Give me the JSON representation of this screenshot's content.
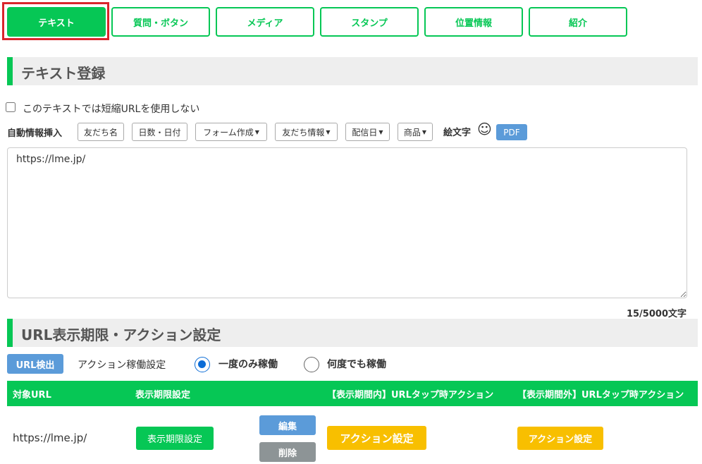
{
  "tabs": [
    {
      "label": "テキスト"
    },
    {
      "label": "質問・ボタン"
    },
    {
      "label": "メディア"
    },
    {
      "label": "スタンプ"
    },
    {
      "label": "位置情報"
    },
    {
      "label": "紹介"
    }
  ],
  "text_section": {
    "title": "テキスト登録",
    "no_short_url_label": "このテキストでは短縮URLを使用しない",
    "auto_insert_label": "自動情報挿入",
    "insert_buttons": {
      "friend_name": "友だち名",
      "days_date": "日数・日付",
      "form_create": "フォーム作成",
      "friend_info": "友だち情報",
      "delivery_date": "配信日",
      "product": "商品"
    },
    "emoji_label": "絵文字",
    "emoji_glyph": "☺",
    "pdf_label": "PDF",
    "message_value": "https://lme.jp/",
    "char_count": "15/5000文字"
  },
  "url_section": {
    "title": "URL表示期限・アクション設定",
    "url_check_button": "URL検出",
    "action_mode_label": "アクション稼働設定",
    "radio_once": "一度のみ稼働",
    "radio_always": "何度でも稼働",
    "table": {
      "headers": [
        "対象URL",
        "表示期限設定",
        "【表示期間内】URLタップ時アクション",
        "【表示期間外】URLタップ時アクション"
      ],
      "row": {
        "url": "https://lme.jp/",
        "period_button": "表示期限設定",
        "edit_button": "編集",
        "delete_button": "削除",
        "action_in_button": "アクション設定",
        "action_out_button": "アクション設定"
      }
    }
  }
}
